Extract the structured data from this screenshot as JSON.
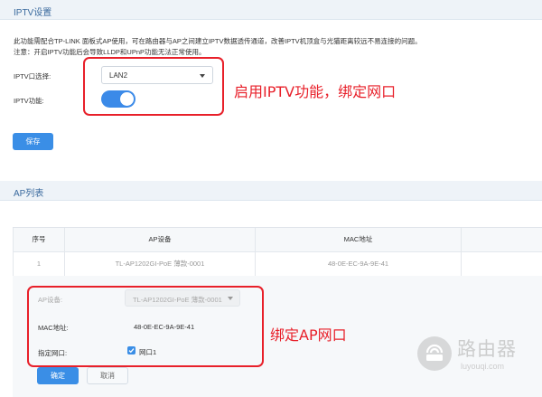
{
  "iptv_section": {
    "title": "IPTV设置",
    "description_line1": "此功能需配合TP-LINK 面板式AP使用，可在路由器与AP之间建立IPTV数据透传通道，改善IPTV机顶盒与光猫距离较远不易连接的问题。",
    "description_line2": "注意：开启IPTV功能后会导致LLDP和UPnP功能无法正常使用。",
    "port_label": "IPTV口选择:",
    "port_value": "LAN2",
    "function_label": "IPTV功能:",
    "function_enabled": true,
    "save_label": "保存",
    "annotation": "启用IPTV功能，绑定网口"
  },
  "ap_section": {
    "title": "AP列表",
    "table": {
      "headers": [
        "序号",
        "AP设备",
        "MAC地址",
        ""
      ],
      "rows": [
        [
          "1",
          "TL-AP1202GI-PoE 薄款-0001",
          "48-0E-EC-9A-9E-41",
          ""
        ]
      ]
    },
    "edit": {
      "device_label": "AP设备:",
      "device_value": "TL-AP1202GI-PoE 薄款-0001",
      "mac_label": "MAC地址:",
      "mac_value": "48-0E-EC-9A-9E-41",
      "port_label": "指定网口:",
      "port_option": "网口1",
      "port_checked": true,
      "confirm_label": "确定",
      "cancel_label": "取消"
    },
    "annotation": "绑定AP网口"
  },
  "watermark": {
    "title": "路由器",
    "subtitle": "luyouqi.com"
  },
  "colors": {
    "accent": "#3a8ee6",
    "annotation_red": "#e8202a",
    "header_bg": "#eef3f8"
  },
  "icons": [
    "chevron-down-icon",
    "checkmark-icon",
    "router-logo-icon"
  ]
}
